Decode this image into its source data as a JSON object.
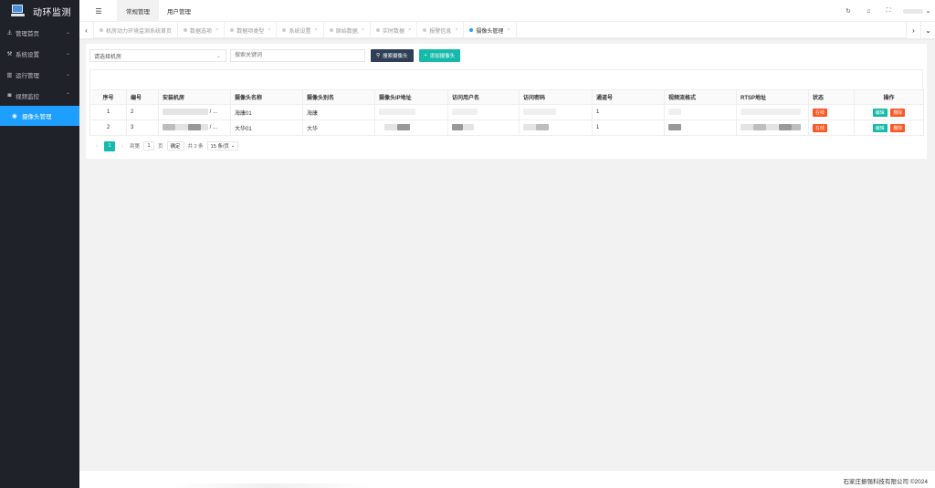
{
  "app": {
    "title": "动环监测"
  },
  "sidebar": {
    "items": [
      {
        "label": "管理首页",
        "icon": "anchor-icon",
        "glyph": "⚓"
      },
      {
        "label": "系统设置",
        "icon": "tool-icon",
        "glyph": "⚒"
      },
      {
        "label": "运行管理",
        "icon": "chart-icon",
        "glyph": "▥"
      },
      {
        "label": "视频监控",
        "icon": "video-icon",
        "glyph": "◙"
      }
    ],
    "sub_items": [
      {
        "label": "摄像头管理",
        "icon": "camera-icon",
        "glyph": "◉"
      }
    ]
  },
  "header": {
    "menu_toggle_glyph": "☰",
    "tabs": [
      {
        "label": "常规管理"
      },
      {
        "label": "用户管理"
      }
    ],
    "icons": {
      "refresh": "↻",
      "bell": "♫",
      "fullscreen": "⛶"
    },
    "user_chevron": "⌄"
  },
  "tabsbar": {
    "left_arrow": "‹",
    "right_arrow": "›",
    "down_arrow": "⌄",
    "tabs": [
      {
        "label": "机房动力环境监测系统首页"
      },
      {
        "label": "数据选项"
      },
      {
        "label": "数据项类型"
      },
      {
        "label": "系统设置"
      },
      {
        "label": "原始数据"
      },
      {
        "label": "实时数据"
      },
      {
        "label": "报警信息"
      },
      {
        "label": "摄像头管理"
      }
    ],
    "close_glyph": "×"
  },
  "toolbar": {
    "room_select_value": "请选择机房",
    "search_placeholder": "搜索关键词",
    "search_button": "搜索摄像头",
    "add_button": "添加摄像头"
  },
  "table": {
    "headers": [
      "序号",
      "编号",
      "安装机房",
      "摄像头名称",
      "摄像头别名",
      "摄像头IP地址",
      "访问用户名",
      "访问密码",
      "通道号",
      "视频流格式",
      "RTSP地址",
      "状态",
      "操作"
    ],
    "rows": [
      {
        "index": "1",
        "code": "2",
        "room_suffix": "/ ...",
        "name": "海康01",
        "alias": "海康",
        "channel": "1",
        "status": "在线",
        "edit": "编辑",
        "delete": "删除"
      },
      {
        "index": "2",
        "code": "3",
        "room_suffix": "/ ...",
        "name": "大华01",
        "alias": "大华",
        "channel": "1",
        "status": "在线",
        "edit": "编辑",
        "delete": "删除"
      }
    ]
  },
  "pager": {
    "prev": "‹",
    "current": "1",
    "next": "›",
    "goto_label": "到第",
    "goto_value": "1",
    "page_unit": "页",
    "confirm": "确定",
    "total": "共 2 条",
    "page_size": "15 条/页"
  },
  "footer": {
    "copyright": "石家庄振强科技有限公司 ©2024"
  },
  "colors": {
    "sidebar_bg": "#20222a",
    "active_blue": "#1e9fff",
    "teal": "#16baaa",
    "danger": "#ff5722",
    "dark_btn": "#2f4056"
  }
}
